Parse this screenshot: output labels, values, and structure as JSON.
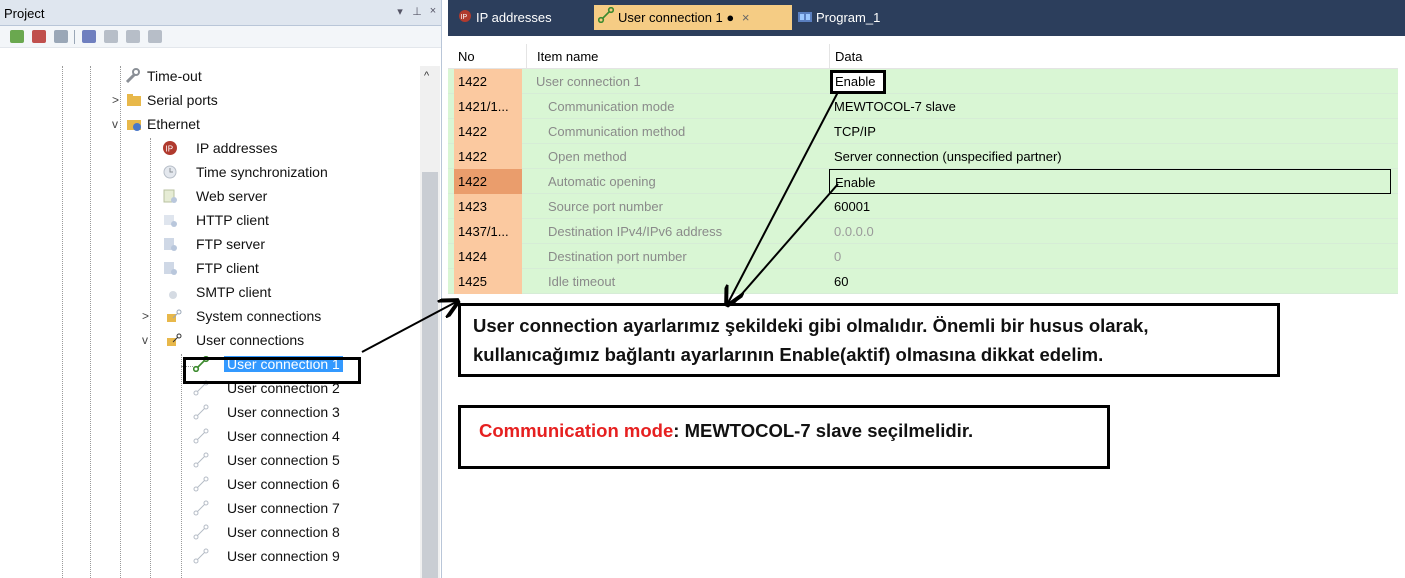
{
  "project_pane": {
    "title": "Project",
    "header_buttons": [
      "▾",
      "⊥",
      "×"
    ],
    "toolbar_icons": [
      "add-node-icon",
      "branch-icon",
      "filter-icon",
      "layers-icon",
      "book-icon",
      "book-edit-icon",
      "stack-icon"
    ],
    "scroll_up": "^",
    "tree": {
      "items": [
        {
          "label": "Time-out",
          "icon": "wrench-icon",
          "expander": ""
        },
        {
          "label": "Serial ports",
          "icon": "folder-icon",
          "expander": ">"
        },
        {
          "label": "Ethernet",
          "icon": "folder-icon",
          "expander": "v"
        },
        {
          "label": "IP addresses",
          "icon": "ip-icon",
          "expander": ""
        },
        {
          "label": "Time synchronization",
          "icon": "clock-icon",
          "expander": ""
        },
        {
          "label": "Web server",
          "icon": "web-server-icon",
          "expander": ""
        },
        {
          "label": "HTTP client",
          "icon": "http-client-icon",
          "expander": ""
        },
        {
          "label": "FTP server",
          "icon": "ftp-server-icon",
          "expander": ""
        },
        {
          "label": "FTP client",
          "icon": "ftp-client-icon",
          "expander": ""
        },
        {
          "label": "SMTP client",
          "icon": "smtp-client-icon",
          "expander": ""
        },
        {
          "label": "System connections",
          "icon": "connection-icon",
          "expander": ">"
        },
        {
          "label": "User connections",
          "icon": "connection-icon",
          "expander": "v"
        },
        {
          "label": "User connection 1",
          "icon": "connection-icon",
          "expander": ""
        },
        {
          "label": "User connection 2",
          "icon": "connection-icon",
          "expander": ""
        },
        {
          "label": "User connection 3",
          "icon": "connection-icon",
          "expander": ""
        },
        {
          "label": "User connection 4",
          "icon": "connection-icon",
          "expander": ""
        },
        {
          "label": "User connection 5",
          "icon": "connection-icon",
          "expander": ""
        },
        {
          "label": "User connection 6",
          "icon": "connection-icon",
          "expander": ""
        },
        {
          "label": "User connection 7",
          "icon": "connection-icon",
          "expander": ""
        },
        {
          "label": "User connection 8",
          "icon": "connection-icon",
          "expander": ""
        },
        {
          "label": "User connection 9",
          "icon": "connection-icon",
          "expander": ""
        }
      ]
    }
  },
  "tabs": [
    {
      "label": "IP addresses",
      "icon": "ip-icon",
      "active": false
    },
    {
      "label": "User connection 1 ●",
      "icon": "connection-icon",
      "active": true,
      "close": "×"
    },
    {
      "label": "Program_1",
      "icon": "program-icon",
      "active": false
    }
  ],
  "grid": {
    "headers": {
      "no": "No",
      "item": "Item name",
      "data": "Data"
    },
    "rows": [
      {
        "no": "1422",
        "item": "User connection 1",
        "data": "Enable",
        "indent": false,
        "gray": false
      },
      {
        "no": "1421/1...",
        "item": "Communication mode",
        "data": "MEWTOCOL-7 slave",
        "indent": true,
        "gray": false
      },
      {
        "no": "1422",
        "item": "Communication method",
        "data": "TCP/IP",
        "indent": true,
        "gray": false
      },
      {
        "no": "1422",
        "item": "Open method",
        "data": "Server connection (unspecified partner)",
        "indent": true,
        "gray": false
      },
      {
        "no": "1422",
        "item": "Automatic opening",
        "data": "Enable",
        "indent": true,
        "gray": false
      },
      {
        "no": "1423",
        "item": "Source port number",
        "data": "60001",
        "indent": true,
        "gray": false
      },
      {
        "no": "1437/1...",
        "item": "Destination IPv4/IPv6 address",
        "data": "0.0.0.0",
        "indent": true,
        "gray": true
      },
      {
        "no": "1424",
        "item": "Destination port number",
        "data": "0",
        "indent": true,
        "gray": true
      },
      {
        "no": "1425",
        "item": "Idle timeout",
        "data": "60",
        "indent": true,
        "gray": false
      }
    ]
  },
  "annotations": {
    "note1_line1": "User connection ayarlarımız şekildeki gibi olmalıdır. Önemli bir husus olarak,",
    "note1_line2": "kullanıcağımız bağlantı ayarlarının Enable(aktif) olmasına dikkat edelim.",
    "note2_red": "Communication mode",
    "note2_rest": ": MEWTOCOL-7 slave  seçilmelidir."
  },
  "colors": {
    "no_cell": "#fbc9a0",
    "no_cell_selected": "#ea9d6c",
    "row_green": "#d9f6d4",
    "tab_bar": "#2c3e5c",
    "tab_active": "#f5cc84",
    "selection": "#3399ff",
    "annotation_red": "#e62020"
  }
}
